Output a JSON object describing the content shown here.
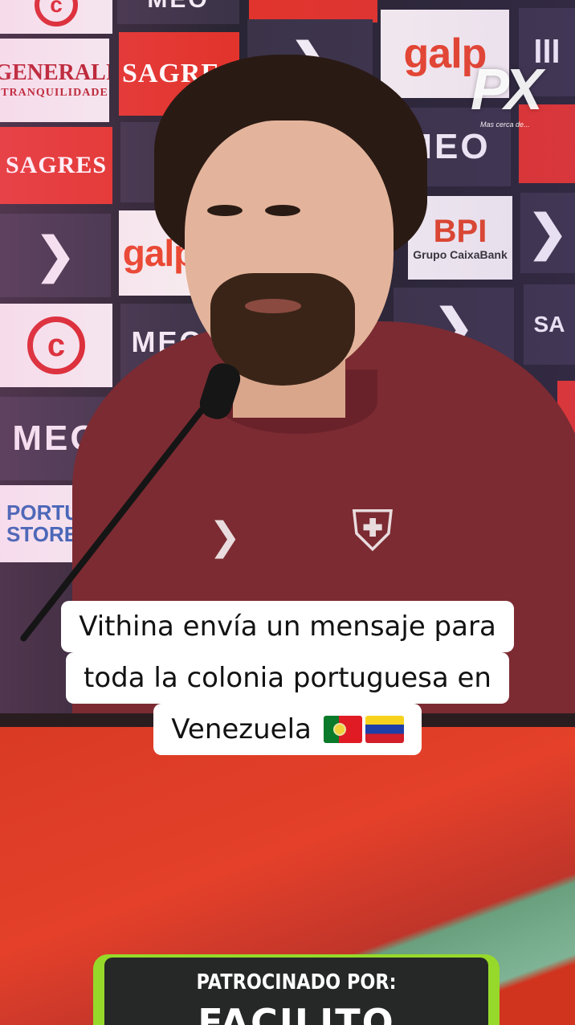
{
  "caption": {
    "line1": "Vithina envía un mensaje para",
    "line2": "toda la colonia portuguesa en",
    "line3": "Venezuela"
  },
  "watermark": {
    "text": "PX",
    "tagline": "Mas cerca de..."
  },
  "sponsor": {
    "label": "PATROCINADO POR:",
    "name": "FACILITO",
    "accent_color": "#96d92a",
    "background_color": "#262727"
  },
  "backdrop_brands": {
    "sagres": "SAGRES",
    "galp": "galp",
    "meo": "MEO",
    "generali": "GENERALI",
    "generali_tagline": "TRANQUILIDADE",
    "bpi": "BPI",
    "bpi_tagline": "Grupo CaixaBank",
    "store_line1": "PORTUG",
    "store_line2": "STORE.FP",
    "partial_sa": "SA"
  },
  "colors": {
    "shirt": "#7c2b32",
    "table": "#e4402a",
    "backdrop_red": "#e2342c"
  }
}
